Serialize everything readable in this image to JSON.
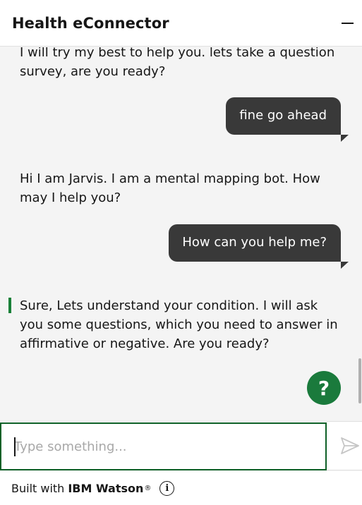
{
  "header": {
    "title": "Health eConnector",
    "minimize_icon": "minimize-icon"
  },
  "messages": [
    {
      "from": "bot",
      "text": "I will try my best to help you. lets take a question survey, are you ready?"
    },
    {
      "from": "user",
      "text": "fine go ahead"
    },
    {
      "from": "bot",
      "text": "Hi I am Jarvis. I am a mental mapping bot. How may I help you?"
    },
    {
      "from": "user",
      "text": "How can you help me?"
    },
    {
      "from": "bot",
      "text": "Sure, Lets understand your condition. I will ask you some questions, which you need to answer in affirmative or negative. Are you ready?"
    }
  ],
  "help_button": {
    "label": "?"
  },
  "input": {
    "placeholder": "Type something...",
    "value": "",
    "send_icon": "send-icon"
  },
  "footer": {
    "prefix": "Built with",
    "brand": "IBM Watson",
    "trademark": "®",
    "info_icon": "info-icon"
  },
  "colors": {
    "accent": "#198038",
    "user_bubble": "#393939",
    "background": "#f4f4f4"
  }
}
